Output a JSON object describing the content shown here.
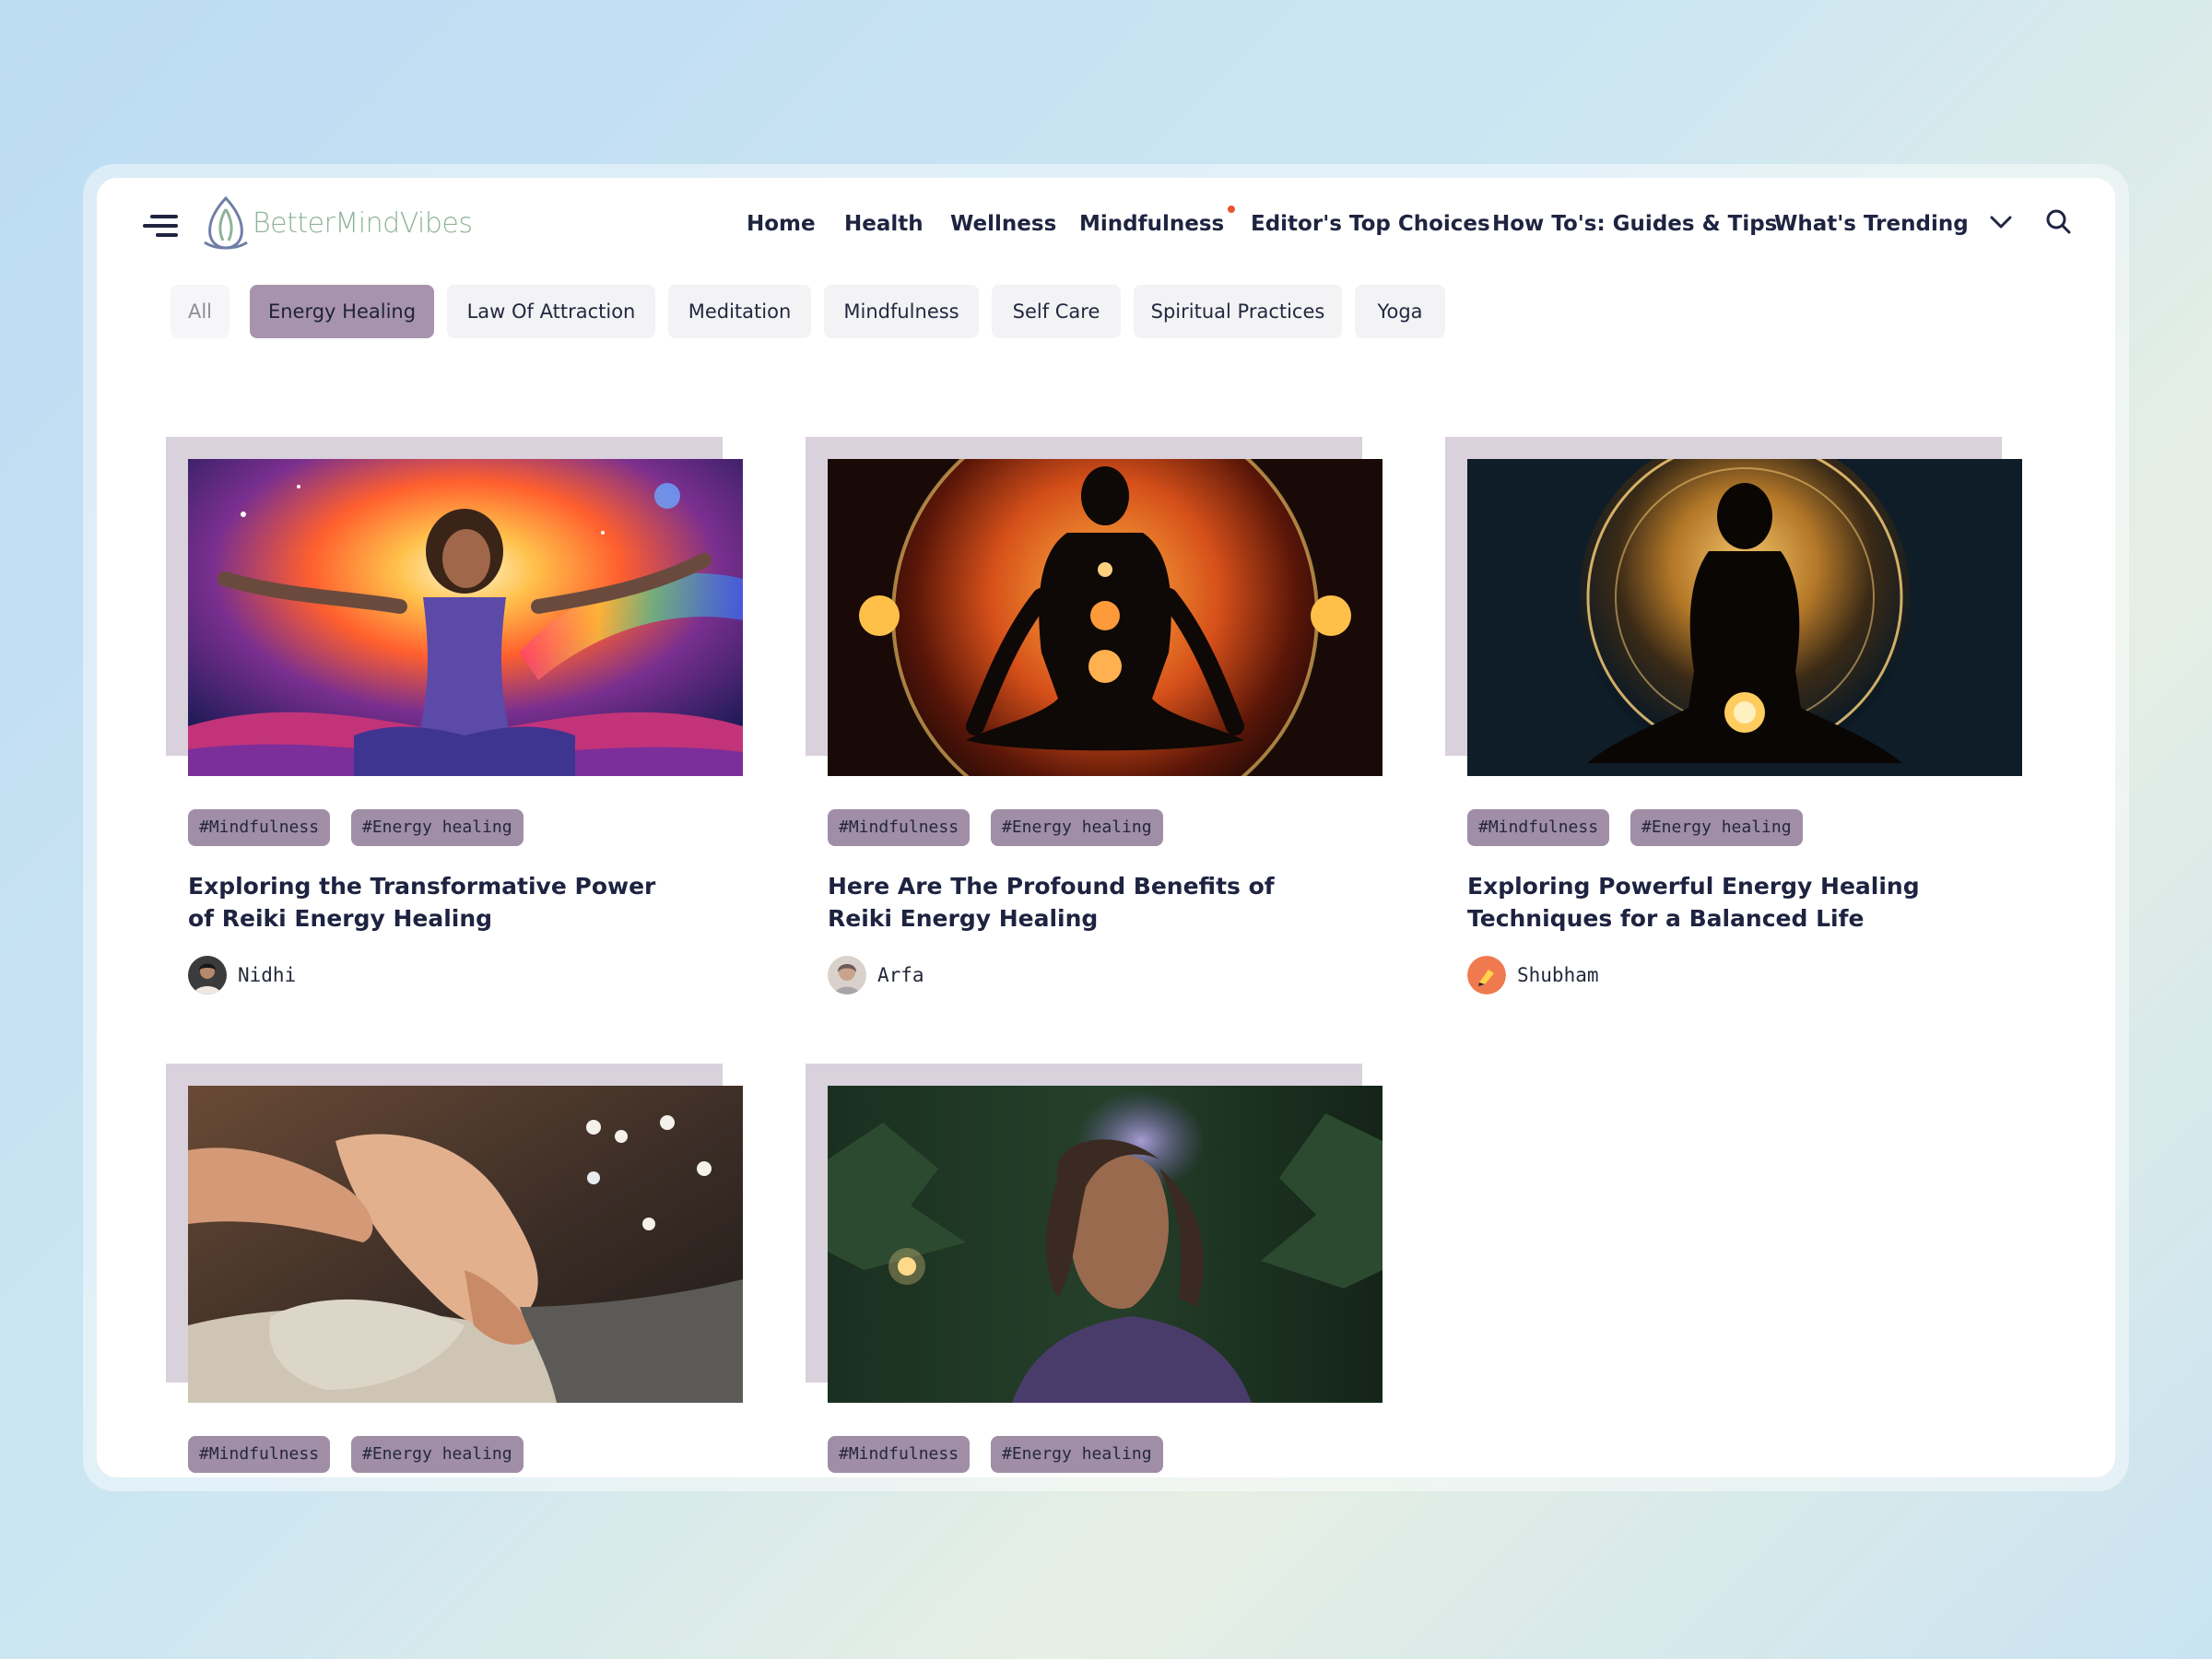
{
  "header": {
    "logo_text": "BetterMindVibes",
    "nav": [
      {
        "label": "Home"
      },
      {
        "label": "Health"
      },
      {
        "label": "Wellness"
      },
      {
        "label": "Mindfulness",
        "has_notification_dot": true
      },
      {
        "label": "Editor's Top Choices"
      },
      {
        "label": "How To's: Guides & Tips"
      },
      {
        "label": "What's Trending"
      }
    ],
    "icons": [
      "menu-icon",
      "chevron-down-icon",
      "search-icon"
    ]
  },
  "categories": {
    "items": [
      "All",
      "Energy Healing",
      "Law Of Attraction",
      "Meditation",
      "Mindfulness",
      "Self Care",
      "Spiritual Practices",
      "Yoga"
    ],
    "selected": "Energy Healing"
  },
  "posts": [
    {
      "tags": [
        "#Mindfulness",
        "#Energy healing"
      ],
      "title": "Exploring the Transformative Power of Reiki Energy Healing",
      "author": "Nidhi",
      "image": "woman-meditating-cosmic-rainbow"
    },
    {
      "tags": [
        "#Mindfulness",
        "#Energy healing"
      ],
      "title": "Here Are The Profound Benefits of Reiki Energy Healing",
      "author": "Arfa",
      "image": "silhouette-chakras-fire-orb"
    },
    {
      "tags": [
        "#Mindfulness",
        "#Energy healing"
      ],
      "title": "Exploring Powerful Energy Healing Techniques for a Balanced Life",
      "author": "Shubham",
      "image": "woman-silhouette-golden-halo"
    },
    {
      "tags": [
        "#Mindfulness",
        "#Energy healing"
      ],
      "title": "",
      "author": "",
      "image": "hands-on-foot-reflexology"
    },
    {
      "tags": [
        "#Mindfulness",
        "#Energy healing"
      ],
      "title": "",
      "author": "",
      "image": "man-forest-smoke"
    }
  ],
  "colors": {
    "accent_pill": "#a893ad",
    "tag_bg": "#a08ea6",
    "logo_green": "#8fb39a",
    "nav_dot": "#e8542e",
    "text_dark": "#1e2440"
  }
}
